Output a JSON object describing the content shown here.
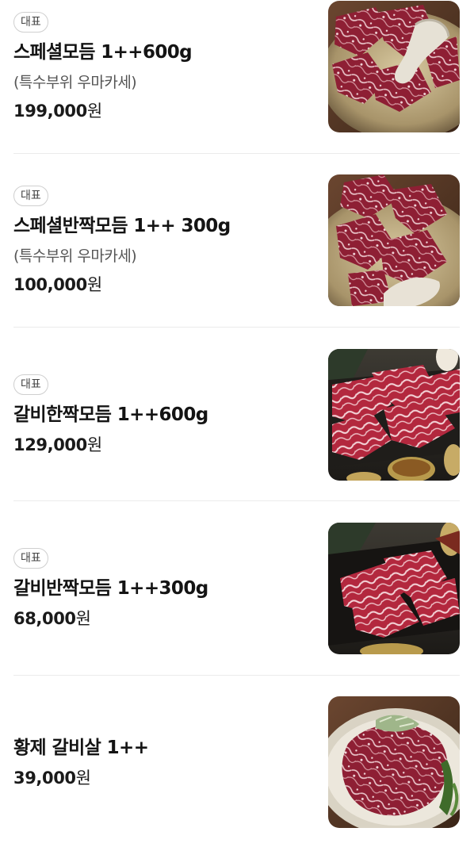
{
  "menu": {
    "items": [
      {
        "badge": "대표",
        "name": "스페셜모듬 1++600g",
        "description": "(특수부위 우마카세)",
        "price": "199,000",
        "unit": "원",
        "image": "marbled-beef-platter-photo"
      },
      {
        "badge": "대표",
        "name": "스페셜반짝모듬 1++ 300g",
        "description": "(특수부위 우마카세)",
        "price": "100,000",
        "unit": "원",
        "image": "marbled-beef-half-platter-photo"
      },
      {
        "badge": "대표",
        "name": "갈비한짝모듬 1++600g",
        "price": "129,000",
        "unit": "원",
        "image": "galbi-platter-photo"
      },
      {
        "badge": "대표",
        "name": "갈비반짝모듬 1++300g",
        "price": "68,000",
        "unit": "원",
        "image": "galbi-half-platter-photo"
      },
      {
        "name": "황제 갈비살 1++",
        "price": "39,000",
        "unit": "원",
        "image": "galbisal-photo"
      }
    ]
  }
}
